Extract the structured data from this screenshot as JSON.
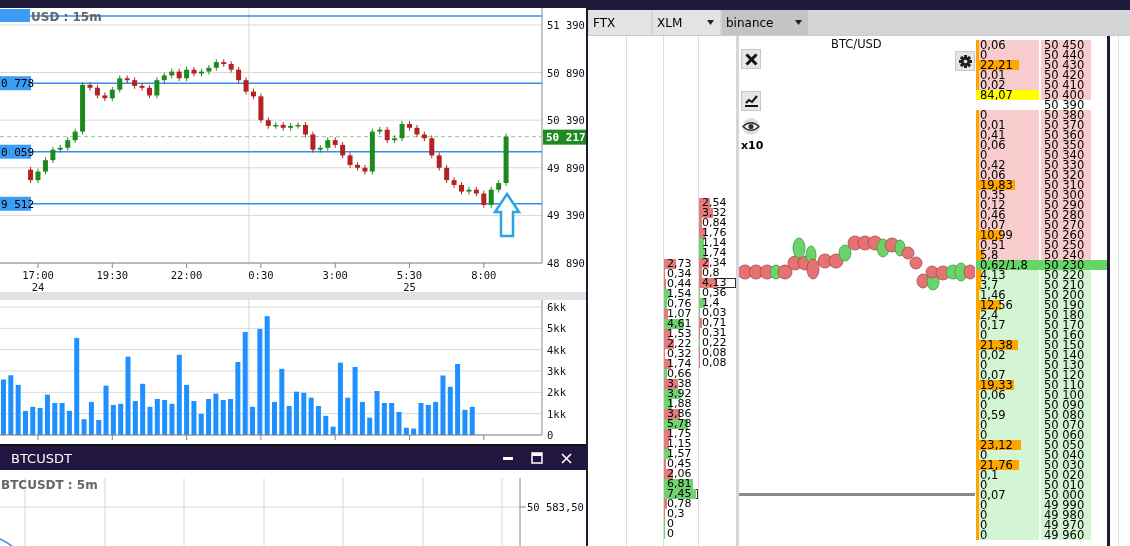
{
  "price_chart": {
    "title": "USD : 15m",
    "level_lines": [
      {
        "label": "0 778"
      },
      {
        "label": "0 059"
      },
      {
        "label": "9 512"
      }
    ],
    "current_price": "50 217",
    "chart_data": {
      "type": "candlestick",
      "grid": true,
      "ylim": [
        48890,
        51568
      ],
      "categories": [
        null,
        null,
        null,
        null,
        null,
        "17:00",
        null,
        null,
        null,
        null,
        null,
        null,
        null,
        null,
        null,
        "19:30",
        null,
        null,
        null,
        null,
        null,
        null,
        null,
        null,
        null,
        "22:00",
        null,
        null,
        null,
        null,
        null,
        null,
        null,
        null,
        null,
        "0:30",
        null,
        null,
        null,
        null,
        null,
        null,
        null,
        null,
        null,
        "3:00",
        null,
        null,
        null,
        null,
        null,
        null,
        null,
        null,
        null,
        "5:30",
        null,
        null,
        null,
        null,
        null,
        null,
        null,
        null,
        null,
        "8:00",
        null,
        null,
        null
      ],
      "ref_lines": [
        {
          "axis": "y",
          "value": 51484
        },
        {
          "axis": "y",
          "value": 50778
        },
        {
          "axis": "y",
          "value": 50059
        },
        {
          "axis": "y",
          "value": 49512
        },
        {
          "axis": "y",
          "value": 50217
        }
      ],
      "ohlc": [
        null,
        null,
        null,
        null,
        [
          49870,
          49900,
          49730,
          49760
        ],
        [
          49760,
          49880,
          49730,
          49850
        ],
        [
          49850,
          50000,
          49820,
          49970
        ],
        [
          49970,
          50110,
          49940,
          50080
        ],
        [
          50080,
          50130,
          50050,
          50100
        ],
        [
          50100,
          50210,
          50070,
          50180
        ],
        [
          50180,
          50300,
          50150,
          50270
        ],
        [
          50270,
          50790,
          50240,
          50760
        ],
        [
          50760,
          50790,
          50700,
          50730
        ],
        [
          50730,
          50760,
          50620,
          50650
        ],
        [
          50650,
          50680,
          50590,
          50620
        ],
        [
          50620,
          50740,
          50590,
          50710
        ],
        [
          50710,
          50860,
          50680,
          50830
        ],
        [
          50830,
          50860,
          50780,
          50810
        ],
        [
          50810,
          50840,
          50720,
          50750
        ],
        [
          50750,
          50780,
          50700,
          50730
        ],
        [
          50730,
          50760,
          50620,
          50650
        ],
        [
          50650,
          50840,
          50620,
          50810
        ],
        [
          50810,
          50890,
          50780,
          50860
        ],
        [
          50860,
          50930,
          50830,
          50900
        ],
        [
          50900,
          50930,
          50800,
          50830
        ],
        [
          50830,
          50950,
          50800,
          50920
        ],
        [
          50920,
          50950,
          50850,
          50880
        ],
        [
          50880,
          50930,
          50850,
          50900
        ],
        [
          50900,
          50970,
          50870,
          50940
        ],
        [
          50940,
          51030,
          50910,
          51000
        ],
        [
          51000,
          51030,
          50950,
          50980
        ],
        [
          50980,
          51010,
          50890,
          50920
        ],
        [
          50920,
          50950,
          50780,
          50810
        ],
        [
          50810,
          50840,
          50660,
          50690
        ],
        [
          50690,
          50720,
          50610,
          50640
        ],
        [
          50640,
          50670,
          50360,
          50390
        ],
        [
          50390,
          50420,
          50300,
          50330
        ],
        [
          50330,
          50370,
          50300,
          50340
        ],
        [
          50340,
          50370,
          50280,
          50310
        ],
        [
          50310,
          50360,
          50280,
          50330
        ],
        [
          50330,
          50370,
          50300,
          50340
        ],
        [
          50340,
          50370,
          50210,
          50240
        ],
        [
          50240,
          50270,
          50050,
          50080
        ],
        [
          50080,
          50130,
          50050,
          50100
        ],
        [
          50100,
          50210,
          50070,
          50180
        ],
        [
          50180,
          50210,
          50100,
          50130
        ],
        [
          50130,
          50160,
          49990,
          50020
        ],
        [
          50020,
          50050,
          49890,
          49920
        ],
        [
          49920,
          49950,
          49860,
          49890
        ],
        [
          49890,
          49920,
          49820,
          49850
        ],
        [
          49850,
          50300,
          49820,
          50270
        ],
        [
          50270,
          50320,
          50240,
          50290
        ],
        [
          50290,
          50320,
          50150,
          50180
        ],
        [
          50180,
          50230,
          50150,
          50200
        ],
        [
          50200,
          50380,
          50170,
          50350
        ],
        [
          50350,
          50380,
          50280,
          50310
        ],
        [
          50310,
          50340,
          50210,
          50240
        ],
        [
          50240,
          50270,
          50170,
          50200
        ],
        [
          50200,
          50230,
          49990,
          50020
        ],
        [
          50020,
          50050,
          49860,
          49890
        ],
        [
          49890,
          49920,
          49730,
          49760
        ],
        [
          49760,
          49790,
          49680,
          49710
        ],
        [
          49710,
          49740,
          49610,
          49640
        ],
        [
          49640,
          49690,
          49610,
          49660
        ],
        [
          49660,
          49690,
          49590,
          49620
        ],
        [
          49620,
          49650,
          49470,
          49500
        ],
        [
          49500,
          49690,
          49470,
          49660
        ],
        [
          49660,
          49760,
          49630,
          49730
        ],
        [
          49730,
          50250,
          49700,
          50217
        ]
      ],
      "yticks": [
        {
          "value": 51390,
          "label": "51 390"
        },
        {
          "value": 50890,
          "label": "50 890"
        },
        {
          "value": 50390,
          "label": "50 390"
        },
        {
          "value": 49890,
          "label": "49 890"
        },
        {
          "value": 49390,
          "label": "49 390"
        },
        {
          "value": 48890,
          "label": "48 890"
        }
      ]
    },
    "dates": [
      "24",
      "25"
    ]
  },
  "volume_chart": {
    "chart_data": {
      "type": "bar",
      "grid": true,
      "ylim": [
        0,
        6
      ],
      "yticks": [
        {
          "value": 0,
          "label": "0"
        },
        {
          "value": 1,
          "label": "1kk"
        },
        {
          "value": 2,
          "label": "2kk"
        },
        {
          "value": 3,
          "label": "3kk"
        },
        {
          "value": 4,
          "label": "4kk"
        },
        {
          "value": 5,
          "label": "5kk"
        },
        {
          "value": 6,
          "label": "6kk"
        }
      ],
      "values": [
        2.6,
        2.8,
        2.35,
        1.13,
        1.32,
        1.27,
        1.89,
        1.5,
        1.5,
        1.13,
        4.55,
        0.74,
        1.55,
        0.7,
        2.31,
        1.41,
        1.46,
        3.67,
        1.59,
        2.4,
        1.32,
        1.69,
        1.64,
        1.46,
        3.76,
        2.35,
        1.59,
        0.99,
        1.69,
        1.94,
        1.64,
        1.69,
        3.42,
        4.83,
        1.32,
        4.97,
        5.57,
        1.55,
        3.1,
        1.36,
        2.03,
        1.98,
        1.75,
        1.36,
        0.9,
        0.39,
        3.39,
        1.75,
        3.19,
        1.55,
        0.81,
        2.06,
        1.5,
        1.5,
        1.08,
        0.34,
        0.3,
        1.5,
        1.41,
        1.55,
        2.79,
        2.26,
        3.33,
        1.18,
        1.32,
        null,
        null,
        null,
        null,
        null,
        null,
        null,
        null,
        null
      ]
    }
  },
  "bottom_window": {
    "title": "BTCUSDT",
    "chart_title": "BTCUSDT : 5m",
    "y_ticks": [
      "50 583,50"
    ]
  },
  "selectors": [
    {
      "label": "FTX",
      "dropdown": false,
      "selected": false
    },
    {
      "label": "XLM",
      "dropdown": true,
      "selected": false
    },
    {
      "label": "binance",
      "dropdown": true,
      "selected": true
    }
  ],
  "trade_columns": [
    {
      "trades": [
        {
          "size": "2,73",
          "buy": false,
          "level": 0.34,
          "boxed": false
        },
        {
          "size": "0,34",
          "buy": false,
          "level": 0.04,
          "boxed": false
        },
        {
          "size": "0,44",
          "buy": false,
          "level": 0.06,
          "boxed": false
        },
        {
          "size": "1,54",
          "buy": true,
          "level": 0.19,
          "boxed": false
        },
        {
          "size": "0,76",
          "buy": true,
          "level": 0.1,
          "boxed": false
        },
        {
          "size": "1,07",
          "buy": false,
          "level": 0.13,
          "boxed": false
        },
        {
          "size": "4,61",
          "buy": true,
          "level": 0.58,
          "boxed": false
        },
        {
          "size": "1,53",
          "buy": false,
          "level": 0.19,
          "boxed": false
        },
        {
          "size": "2,22",
          "buy": false,
          "level": 0.28,
          "boxed": false
        },
        {
          "size": "0,32",
          "buy": false,
          "level": 0.04,
          "boxed": false
        },
        {
          "size": "1,74",
          "buy": false,
          "level": 0.22,
          "boxed": false
        },
        {
          "size": "0,66",
          "buy": true,
          "level": 0.08,
          "boxed": false
        },
        {
          "size": "3,38",
          "buy": false,
          "level": 0.42,
          "boxed": false
        },
        {
          "size": "3,92",
          "buy": true,
          "level": 0.49,
          "boxed": false
        },
        {
          "size": "1,88",
          "buy": true,
          "level": 0.24,
          "boxed": false
        },
        {
          "size": "3,86",
          "buy": false,
          "level": 0.48,
          "boxed": false
        },
        {
          "size": "5,78",
          "buy": true,
          "level": 0.72,
          "boxed": false
        },
        {
          "size": "1,75",
          "buy": false,
          "level": 0.22,
          "boxed": false
        },
        {
          "size": "1,15",
          "buy": false,
          "level": 0.14,
          "boxed": false
        },
        {
          "size": "1,57",
          "buy": true,
          "level": 0.2,
          "boxed": false
        },
        {
          "size": "0,45",
          "buy": false,
          "level": 0.06,
          "boxed": false
        },
        {
          "size": "2,06",
          "buy": false,
          "level": 0.26,
          "boxed": false
        },
        {
          "size": "6,81",
          "buy": true,
          "level": 0.85,
          "boxed": false
        },
        {
          "size": "7,45",
          "buy": true,
          "level": 0.93,
          "boxed": true
        },
        {
          "size": "0,78",
          "buy": false,
          "level": 0.1,
          "boxed": false
        },
        {
          "size": "0,3",
          "buy": false,
          "level": 0.04,
          "boxed": false
        },
        {
          "size": "0",
          "buy": true,
          "level": 0.02,
          "boxed": false
        },
        {
          "size": "0",
          "buy": true,
          "level": 0.02,
          "boxed": false
        }
      ]
    },
    {
      "trades": [
        {
          "size": "2,54",
          "buy": false,
          "level": 0.32,
          "boxed": false
        },
        {
          "size": "3,32",
          "buy": false,
          "level": 0.42,
          "boxed": false
        },
        {
          "size": "0,84",
          "buy": false,
          "level": 0.1,
          "boxed": false
        },
        {
          "size": "1,76",
          "buy": false,
          "level": 0.22,
          "boxed": false
        },
        {
          "size": "1,14",
          "buy": true,
          "level": 0.14,
          "boxed": false
        },
        {
          "size": "1,74",
          "buy": true,
          "level": 0.22,
          "boxed": false
        },
        {
          "size": "2,34",
          "buy": false,
          "level": 0.29,
          "boxed": false
        },
        {
          "size": "0,8",
          "buy": false,
          "level": 0.1,
          "boxed": false
        },
        {
          "size": "4,13",
          "buy": false,
          "level": 0.52,
          "boxed": true
        },
        {
          "size": "0,36",
          "buy": true,
          "level": 0.04,
          "boxed": false
        },
        {
          "size": "1,4",
          "buy": true,
          "level": 0.18,
          "boxed": false
        },
        {
          "size": "0,03",
          "buy": true,
          "level": 0.02,
          "boxed": false
        },
        {
          "size": "0,71",
          "buy": false,
          "level": 0.09,
          "boxed": false
        },
        {
          "size": "0,31",
          "buy": false,
          "level": 0.04,
          "boxed": false
        },
        {
          "size": "0,22",
          "buy": true,
          "level": 0.03,
          "boxed": false
        },
        {
          "size": "0,08",
          "buy": false,
          "level": 0.02,
          "boxed": false
        },
        {
          "size": "0,08",
          "buy": false,
          "level": 0.02,
          "boxed": false
        }
      ]
    }
  ],
  "heatmap": {
    "title": "BTC/USD",
    "zoom_label": "x10"
  },
  "order_book": [
    {
      "size": "0,06",
      "price": "50 450",
      "kind": "ask",
      "level": 0,
      "marked": false
    },
    {
      "size": "0",
      "price": "50 440",
      "kind": "ask",
      "level": 0,
      "marked": false
    },
    {
      "size": "22,21",
      "price": "50 430",
      "kind": "ask",
      "level": 0.69,
      "marked": false
    },
    {
      "size": "0,01",
      "price": "50 420",
      "kind": "ask",
      "level": 0,
      "marked": false
    },
    {
      "size": "0,02",
      "price": "50 410",
      "kind": "ask",
      "level": 0,
      "marked": false
    },
    {
      "size": "84,07",
      "price": "50 400",
      "kind": "ask",
      "level": 1,
      "marked": true
    },
    {
      "price": "50 390",
      "kind": "gap"
    },
    {
      "size": "0",
      "price": "50 380",
      "kind": "ask",
      "level": 0,
      "marked": false
    },
    {
      "size": "0,01",
      "price": "50 370",
      "kind": "ask",
      "level": 0,
      "marked": false
    },
    {
      "size": "0,41",
      "price": "50 360",
      "kind": "ask",
      "level": 0.01,
      "marked": false
    },
    {
      "size": "0,06",
      "price": "50 350",
      "kind": "ask",
      "level": 0,
      "marked": false
    },
    {
      "size": "0",
      "price": "50 340",
      "kind": "ask",
      "level": 0,
      "marked": false
    },
    {
      "size": "0,42",
      "price": "50 330",
      "kind": "ask",
      "level": 0.01,
      "marked": false
    },
    {
      "size": "0,06",
      "price": "50 320",
      "kind": "ask",
      "level": 0,
      "marked": false
    },
    {
      "size": "19,83",
      "price": "50 310",
      "kind": "ask",
      "level": 0.62,
      "marked": false
    },
    {
      "size": "0,35",
      "price": "50 300",
      "kind": "ask",
      "level": 0.01,
      "marked": false
    },
    {
      "size": "0,12",
      "price": "50 290",
      "kind": "ask",
      "level": 0,
      "marked": false
    },
    {
      "size": "0,46",
      "price": "50 280",
      "kind": "ask",
      "level": 0.01,
      "marked": false
    },
    {
      "size": "0,07",
      "price": "50 270",
      "kind": "ask",
      "level": 0,
      "marked": false
    },
    {
      "size": "10,99",
      "price": "50 260",
      "kind": "ask",
      "level": 0.42,
      "marked": false
    },
    {
      "size": "0,51",
      "price": "50 250",
      "kind": "ask",
      "level": 0.02,
      "marked": false
    },
    {
      "size": "5,8",
      "price": "50 240",
      "kind": "ask",
      "level": 0.12,
      "marked": false
    },
    {
      "size": "0,62/1,8",
      "price": "50 230",
      "kind": "last"
    },
    {
      "size": "4,13",
      "price": "50 220",
      "kind": "bid",
      "level": 0.1,
      "marked": false
    },
    {
      "size": "3,7",
      "price": "50 210",
      "kind": "bid",
      "level": 0.08,
      "marked": false
    },
    {
      "size": "1,46",
      "price": "50 200",
      "kind": "bid",
      "level": 0.04,
      "marked": false
    },
    {
      "size": "12,56",
      "price": "50 190",
      "kind": "bid",
      "level": 0.39,
      "marked": false
    },
    {
      "size": "2,4",
      "price": "50 180",
      "kind": "bid",
      "level": 0.07,
      "marked": false
    },
    {
      "size": "0,17",
      "price": "50 170",
      "kind": "bid",
      "level": 0.01,
      "marked": false
    },
    {
      "size": "0",
      "price": "50 160",
      "kind": "bid",
      "level": 0,
      "marked": false
    },
    {
      "size": "21,38",
      "price": "50 150",
      "kind": "bid",
      "level": 0.67,
      "marked": false
    },
    {
      "size": "0,02",
      "price": "50 140",
      "kind": "bid",
      "level": 0,
      "marked": false
    },
    {
      "size": "0",
      "price": "50 130",
      "kind": "bid",
      "level": 0,
      "marked": false
    },
    {
      "size": "0,07",
      "price": "50 120",
      "kind": "bid",
      "level": 0,
      "marked": false
    },
    {
      "size": "19,33",
      "price": "50 110",
      "kind": "bid",
      "level": 0.6,
      "marked": false
    },
    {
      "size": "0,06",
      "price": "50 100",
      "kind": "bid",
      "level": 0,
      "marked": false
    },
    {
      "size": "0",
      "price": "50 090",
      "kind": "bid",
      "level": 0,
      "marked": false
    },
    {
      "size": "0,59",
      "price": "50 080",
      "kind": "bid",
      "level": 0.02,
      "marked": false
    },
    {
      "size": "0",
      "price": "50 070",
      "kind": "bid",
      "level": 0,
      "marked": false
    },
    {
      "size": "0",
      "price": "50 060",
      "kind": "bid",
      "level": 0,
      "marked": false
    },
    {
      "size": "23,12",
      "price": "50 050",
      "kind": "bid",
      "level": 0.72,
      "marked": false
    },
    {
      "size": "0",
      "price": "50 040",
      "kind": "bid",
      "level": 0,
      "marked": false
    },
    {
      "size": "21,76",
      "price": "50 030",
      "kind": "bid",
      "level": 0.68,
      "marked": false
    },
    {
      "size": "0,1",
      "price": "50 020",
      "kind": "bid",
      "level": 0,
      "marked": false
    },
    {
      "size": "0",
      "price": "50 010",
      "kind": "bid",
      "level": 0,
      "marked": false
    },
    {
      "size": "0,07",
      "price": "50 000",
      "kind": "bid",
      "level": 0,
      "marked": false
    },
    {
      "size": "0",
      "price": "49 990",
      "kind": "bid",
      "level": 0,
      "marked": false
    },
    {
      "size": "0",
      "price": "49 980",
      "kind": "bid",
      "level": 0,
      "marked": false
    },
    {
      "size": "0",
      "price": "49 970",
      "kind": "bid",
      "level": 0,
      "marked": false
    },
    {
      "size": "0",
      "price": "49 960",
      "kind": "bid",
      "level": 0,
      "marked": false
    }
  ]
}
